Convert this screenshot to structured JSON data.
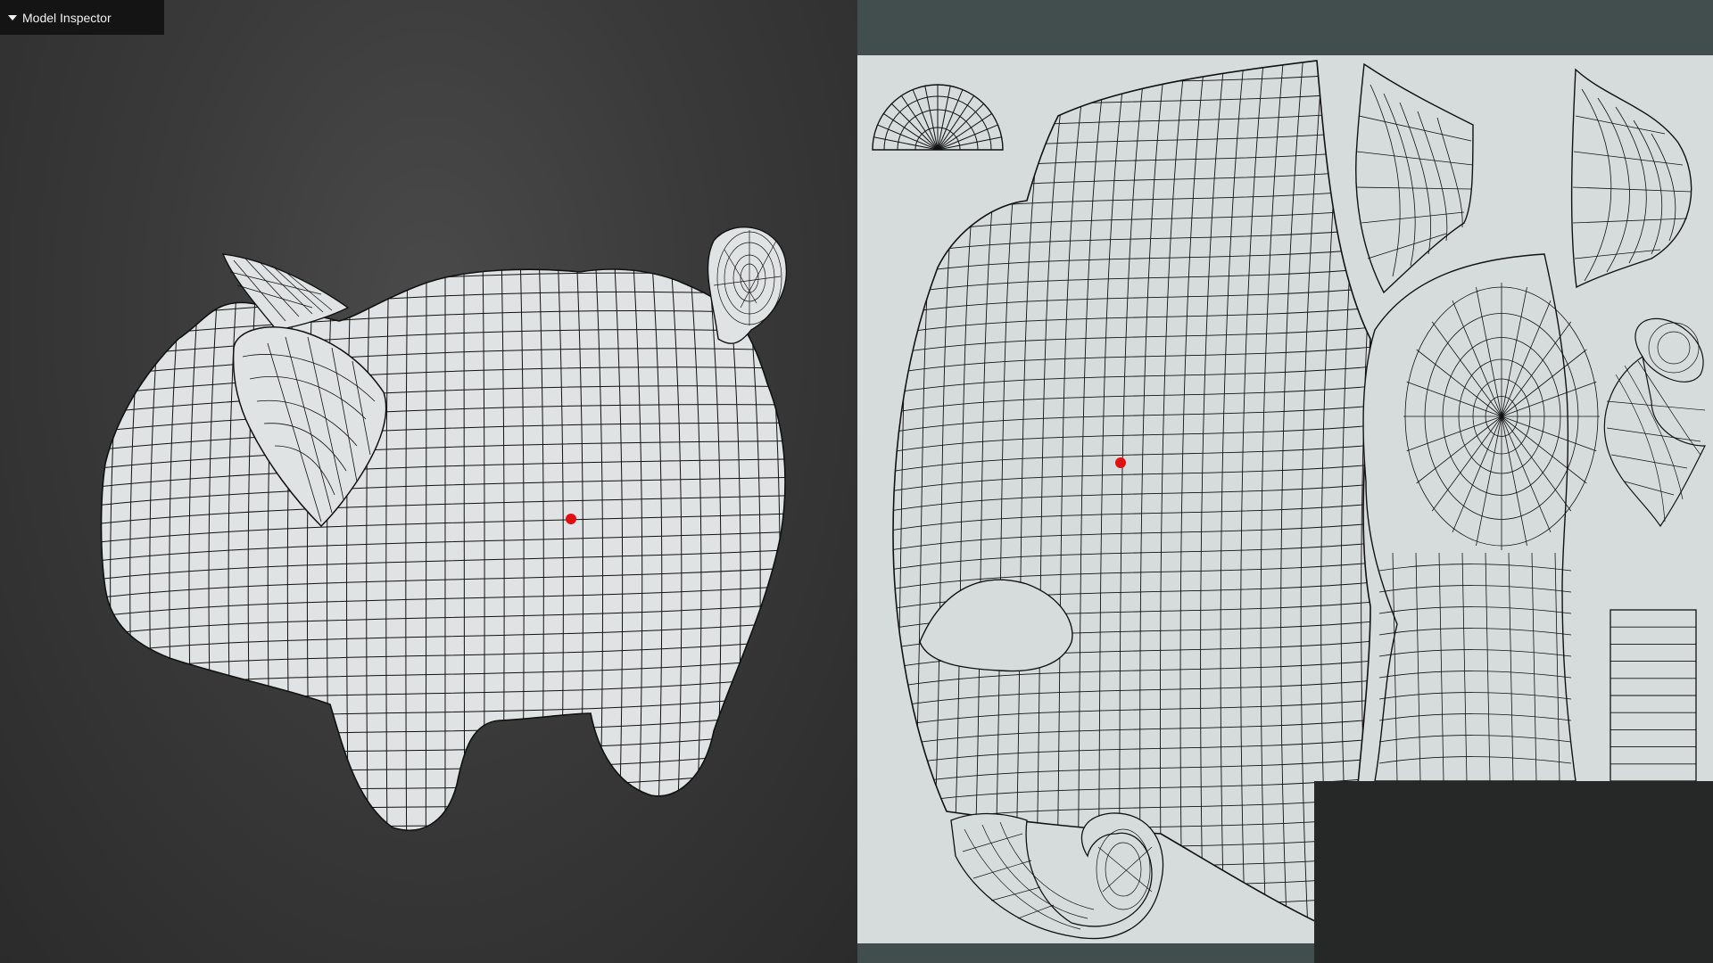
{
  "inspector": {
    "title": "Model Inspector",
    "toggle_icon": "caret-down-icon",
    "expanded": true
  },
  "viewport": {
    "model": "pig",
    "render_mode": "wireframe",
    "background": "#3a3a3a",
    "mesh_fill": "#dfe3e3",
    "wire_color": "#111111"
  },
  "uv_editor": {
    "background": "#424e4e",
    "canvas_fill": "#d6dcdc",
    "islands": [
      "body",
      "half-disc",
      "ear-left",
      "ear-right",
      "snout-cap",
      "tail-right",
      "tail-bottom",
      "leg-strip"
    ]
  },
  "selection": {
    "marker_color": "#e01010"
  }
}
